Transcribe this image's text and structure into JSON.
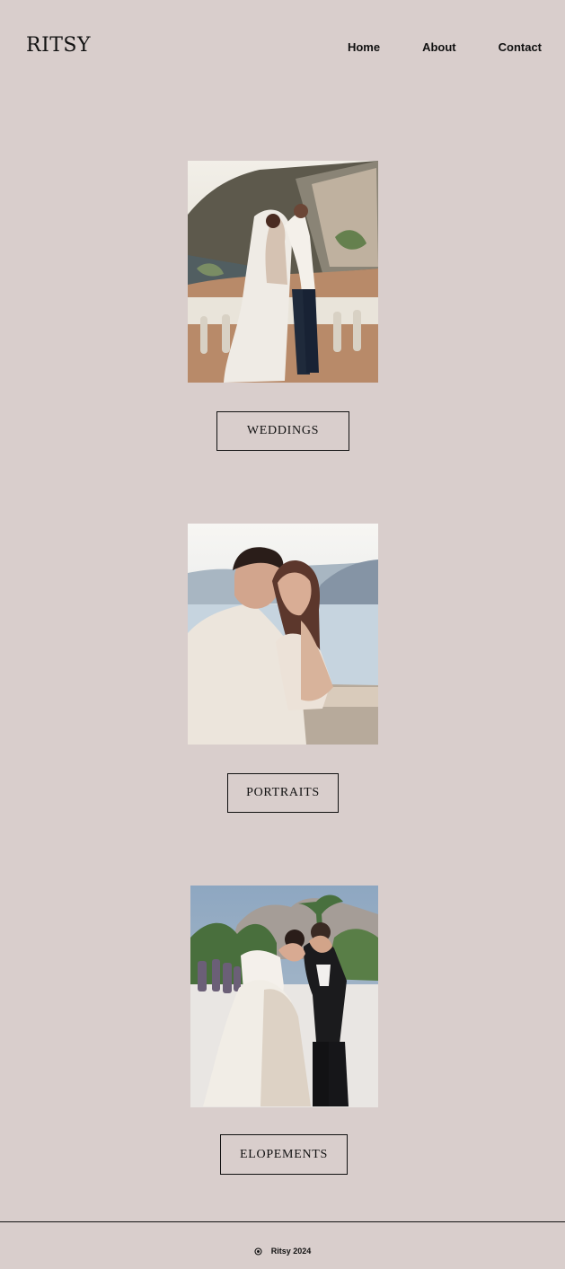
{
  "brand": {
    "logo": "RITSY"
  },
  "nav": {
    "items": [
      {
        "label": "Home"
      },
      {
        "label": "About"
      },
      {
        "label": "Contact"
      }
    ]
  },
  "sections": [
    {
      "label": "WEDDINGS"
    },
    {
      "label": "PORTRAITS"
    },
    {
      "label": "ELOPEMENTS"
    }
  ],
  "footer": {
    "text": "Ritsy 2024",
    "icon": "copyright-icon"
  }
}
